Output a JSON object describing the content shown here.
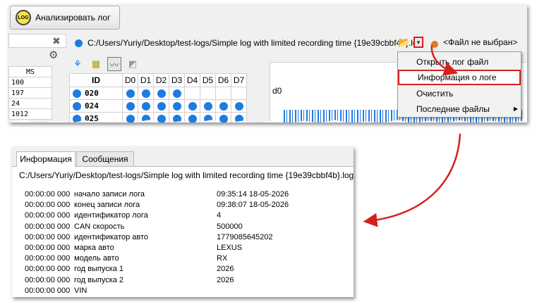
{
  "top": {
    "analyze_button_label": "Анализировать лог",
    "log_icon_text": "LOG",
    "ms_header": "MS",
    "ms_values": [
      "100",
      "197",
      "24",
      "1012"
    ],
    "file_path": "C:/Users/Yuriy/Desktop/test-logs/Simple log with limited recording time {19e39cbbf4b}.log",
    "no_file_label": "<Файл не выбран>",
    "grid": {
      "id_header": "ID",
      "bit_headers": [
        "D0",
        "D1",
        "D2",
        "D3",
        "D4",
        "D5",
        "D6",
        "D7"
      ],
      "rows": [
        {
          "id": "020",
          "bits": [
            true,
            true,
            true,
            true,
            false,
            false,
            false,
            false
          ]
        },
        {
          "id": "024",
          "bits": [
            true,
            true,
            true,
            true,
            true,
            true,
            true,
            true
          ]
        },
        {
          "id": "025",
          "bits": [
            true,
            true,
            true,
            true,
            true,
            true,
            true,
            true
          ]
        }
      ]
    },
    "chart_label": "d0",
    "menu": {
      "items": [
        "Открыть лог файл",
        "Информация о логе",
        "Очистить",
        "Последние файлы"
      ]
    }
  },
  "bottom": {
    "tabs": [
      "Информация",
      "Сообщения"
    ],
    "log_path": "C:/Users/Yuriy/Desktop/test-logs/Simple log with limited recording time {19e39cbbf4b}.log",
    "rows": [
      {
        "time": "00:00:00 000",
        "key": "начало записи лога",
        "value": "09:35:14 18-05-2026"
      },
      {
        "time": "00:00:00 000",
        "key": "конец записи лога",
        "value": "09:38:07 18-05-2026"
      },
      {
        "time": "00:00:00 000",
        "key": "идентификатор лога",
        "value": "4"
      },
      {
        "time": "00:00:00 000",
        "key": "CAN скорость",
        "value": "500000"
      },
      {
        "time": "00:00:00 000",
        "key": "идентификатор авто",
        "value": "1779085645202"
      },
      {
        "time": "00:00:00 000",
        "key": "марка авто",
        "value": "LEXUS"
      },
      {
        "time": "00:00:00 000",
        "key": "модель авто",
        "value": "RX"
      },
      {
        "time": "00:00:00 000",
        "key": "год выпуска 1",
        "value": "2026"
      },
      {
        "time": "00:00:00 000",
        "key": "год выпуска 2",
        "value": "2026"
      },
      {
        "time": "00:00:00 000",
        "key": "VIN",
        "value": ""
      }
    ]
  },
  "colors": {
    "accent_blue": "#1e7be0",
    "highlight_red": "#d62020",
    "orange": "#e07a20"
  }
}
